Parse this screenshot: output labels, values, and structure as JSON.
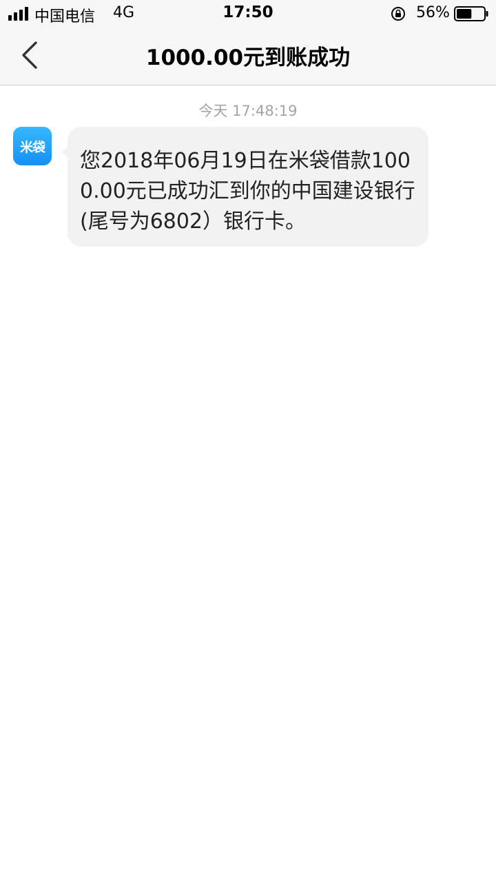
{
  "status_bar": {
    "carrier": "中国电信",
    "network": "4G",
    "time": "17:50",
    "battery_percent": "56%",
    "battery_level": 0.56,
    "signal_bars": 4
  },
  "nav": {
    "title": "1000.00元到账成功",
    "back_icon": "chevron-left-icon"
  },
  "conversation": {
    "timestamp": "今天 17:48:19",
    "sender_avatar_text": "米袋",
    "message": "您2018年06月19日在米袋借款1000.00元已成功汇到你的中国建设银行(尾号为6802）银行卡。"
  },
  "colors": {
    "header_bg": "#f7f7f7",
    "bubble_bg": "#f2f2f2",
    "avatar_blue": "#1690f5",
    "timestamp_gray": "#a4a4a4"
  }
}
